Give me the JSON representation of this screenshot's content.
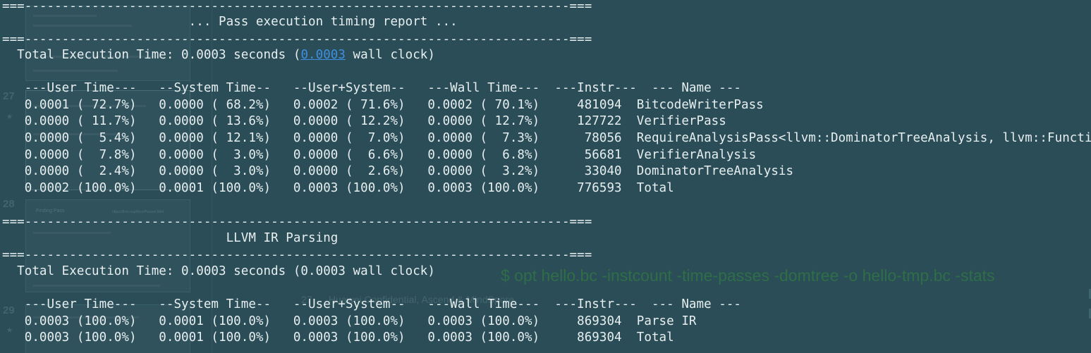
{
  "background": "#2a4d58",
  "text_color": "#e8eff0",
  "link_color": "#3f8fe0",
  "overlay": {
    "command": "$ opt hello.bc -instcount -time-passes -domtree -o hello-tmp.bc -stats",
    "confidential_num": "27",
    "confidential": "Huawei Confidential, Ascend & MindSpore",
    "slide_nums": [
      "27",
      "28",
      "29"
    ],
    "thumb_title": "Finding Pass",
    "thumb_url": "https://llvm.org/docs/Passes.html"
  },
  "report1": {
    "rule": "===-------------------------------------------------------------------------===",
    "title": "                         ... Pass execution timing report ...",
    "total_prefix": "  Total Execution Time: 0.0003 seconds (",
    "total_link": "0.0003",
    "total_suffix": " wall clock)",
    "header": "   ---User Time---   --System Time--   --User+System--   ---Wall Time---  ---Instr---  --- Name ---",
    "rows": [
      "   0.0001 ( 72.7%)   0.0000 ( 68.2%)   0.0002 ( 71.6%)   0.0002 ( 70.1%)     481094  BitcodeWriterPass",
      "   0.0000 ( 11.7%)   0.0000 ( 13.6%)   0.0000 ( 12.2%)   0.0000 ( 12.7%)     127722  VerifierPass",
      "   0.0000 (  5.4%)   0.0000 ( 12.1%)   0.0000 (  7.0%)   0.0000 (  7.3%)      78056  RequireAnalysisPass<llvm::DominatorTreeAnalysis, llvm::Function>",
      "   0.0000 (  7.8%)   0.0000 (  3.0%)   0.0000 (  6.6%)   0.0000 (  6.8%)      56681  VerifierAnalysis",
      "   0.0000 (  2.4%)   0.0000 (  3.0%)   0.0000 (  2.6%)   0.0000 (  3.2%)      33040  DominatorTreeAnalysis",
      "   0.0002 (100.0%)   0.0001 (100.0%)   0.0003 (100.0%)   0.0003 (100.0%)     776593  Total"
    ]
  },
  "report2": {
    "rule": "===-------------------------------------------------------------------------===",
    "title": "                              LLVM IR Parsing",
    "total": "  Total Execution Time: 0.0003 seconds (0.0003 wall clock)",
    "header": "   ---User Time---   --System Time--   --User+System--   ---Wall Time---  ---Instr---  --- Name ---",
    "rows": [
      "   0.0003 (100.0%)   0.0001 (100.0%)   0.0003 (100.0%)   0.0003 (100.0%)     869304  Parse IR",
      "   0.0003 (100.0%)   0.0001 (100.0%)   0.0003 (100.0%)   0.0003 (100.0%)     869304  Total"
    ]
  }
}
